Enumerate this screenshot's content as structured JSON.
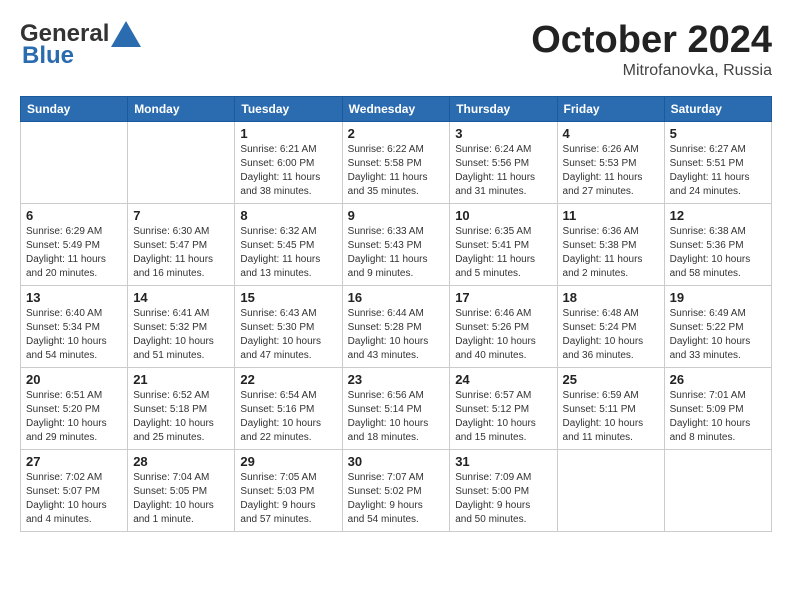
{
  "header": {
    "logo_line1": "General",
    "logo_line2": "Blue",
    "month": "October 2024",
    "location": "Mitrofanovka, Russia"
  },
  "weekdays": [
    "Sunday",
    "Monday",
    "Tuesday",
    "Wednesday",
    "Thursday",
    "Friday",
    "Saturday"
  ],
  "weeks": [
    [
      {
        "day": "",
        "info": ""
      },
      {
        "day": "",
        "info": ""
      },
      {
        "day": "1",
        "info": "Sunrise: 6:21 AM\nSunset: 6:00 PM\nDaylight: 11 hours\nand 38 minutes."
      },
      {
        "day": "2",
        "info": "Sunrise: 6:22 AM\nSunset: 5:58 PM\nDaylight: 11 hours\nand 35 minutes."
      },
      {
        "day": "3",
        "info": "Sunrise: 6:24 AM\nSunset: 5:56 PM\nDaylight: 11 hours\nand 31 minutes."
      },
      {
        "day": "4",
        "info": "Sunrise: 6:26 AM\nSunset: 5:53 PM\nDaylight: 11 hours\nand 27 minutes."
      },
      {
        "day": "5",
        "info": "Sunrise: 6:27 AM\nSunset: 5:51 PM\nDaylight: 11 hours\nand 24 minutes."
      }
    ],
    [
      {
        "day": "6",
        "info": "Sunrise: 6:29 AM\nSunset: 5:49 PM\nDaylight: 11 hours\nand 20 minutes."
      },
      {
        "day": "7",
        "info": "Sunrise: 6:30 AM\nSunset: 5:47 PM\nDaylight: 11 hours\nand 16 minutes."
      },
      {
        "day": "8",
        "info": "Sunrise: 6:32 AM\nSunset: 5:45 PM\nDaylight: 11 hours\nand 13 minutes."
      },
      {
        "day": "9",
        "info": "Sunrise: 6:33 AM\nSunset: 5:43 PM\nDaylight: 11 hours\nand 9 minutes."
      },
      {
        "day": "10",
        "info": "Sunrise: 6:35 AM\nSunset: 5:41 PM\nDaylight: 11 hours\nand 5 minutes."
      },
      {
        "day": "11",
        "info": "Sunrise: 6:36 AM\nSunset: 5:38 PM\nDaylight: 11 hours\nand 2 minutes."
      },
      {
        "day": "12",
        "info": "Sunrise: 6:38 AM\nSunset: 5:36 PM\nDaylight: 10 hours\nand 58 minutes."
      }
    ],
    [
      {
        "day": "13",
        "info": "Sunrise: 6:40 AM\nSunset: 5:34 PM\nDaylight: 10 hours\nand 54 minutes."
      },
      {
        "day": "14",
        "info": "Sunrise: 6:41 AM\nSunset: 5:32 PM\nDaylight: 10 hours\nand 51 minutes."
      },
      {
        "day": "15",
        "info": "Sunrise: 6:43 AM\nSunset: 5:30 PM\nDaylight: 10 hours\nand 47 minutes."
      },
      {
        "day": "16",
        "info": "Sunrise: 6:44 AM\nSunset: 5:28 PM\nDaylight: 10 hours\nand 43 minutes."
      },
      {
        "day": "17",
        "info": "Sunrise: 6:46 AM\nSunset: 5:26 PM\nDaylight: 10 hours\nand 40 minutes."
      },
      {
        "day": "18",
        "info": "Sunrise: 6:48 AM\nSunset: 5:24 PM\nDaylight: 10 hours\nand 36 minutes."
      },
      {
        "day": "19",
        "info": "Sunrise: 6:49 AM\nSunset: 5:22 PM\nDaylight: 10 hours\nand 33 minutes."
      }
    ],
    [
      {
        "day": "20",
        "info": "Sunrise: 6:51 AM\nSunset: 5:20 PM\nDaylight: 10 hours\nand 29 minutes."
      },
      {
        "day": "21",
        "info": "Sunrise: 6:52 AM\nSunset: 5:18 PM\nDaylight: 10 hours\nand 25 minutes."
      },
      {
        "day": "22",
        "info": "Sunrise: 6:54 AM\nSunset: 5:16 PM\nDaylight: 10 hours\nand 22 minutes."
      },
      {
        "day": "23",
        "info": "Sunrise: 6:56 AM\nSunset: 5:14 PM\nDaylight: 10 hours\nand 18 minutes."
      },
      {
        "day": "24",
        "info": "Sunrise: 6:57 AM\nSunset: 5:12 PM\nDaylight: 10 hours\nand 15 minutes."
      },
      {
        "day": "25",
        "info": "Sunrise: 6:59 AM\nSunset: 5:11 PM\nDaylight: 10 hours\nand 11 minutes."
      },
      {
        "day": "26",
        "info": "Sunrise: 7:01 AM\nSunset: 5:09 PM\nDaylight: 10 hours\nand 8 minutes."
      }
    ],
    [
      {
        "day": "27",
        "info": "Sunrise: 7:02 AM\nSunset: 5:07 PM\nDaylight: 10 hours\nand 4 minutes."
      },
      {
        "day": "28",
        "info": "Sunrise: 7:04 AM\nSunset: 5:05 PM\nDaylight: 10 hours\nand 1 minute."
      },
      {
        "day": "29",
        "info": "Sunrise: 7:05 AM\nSunset: 5:03 PM\nDaylight: 9 hours\nand 57 minutes."
      },
      {
        "day": "30",
        "info": "Sunrise: 7:07 AM\nSunset: 5:02 PM\nDaylight: 9 hours\nand 54 minutes."
      },
      {
        "day": "31",
        "info": "Sunrise: 7:09 AM\nSunset: 5:00 PM\nDaylight: 9 hours\nand 50 minutes."
      },
      {
        "day": "",
        "info": ""
      },
      {
        "day": "",
        "info": ""
      }
    ]
  ]
}
